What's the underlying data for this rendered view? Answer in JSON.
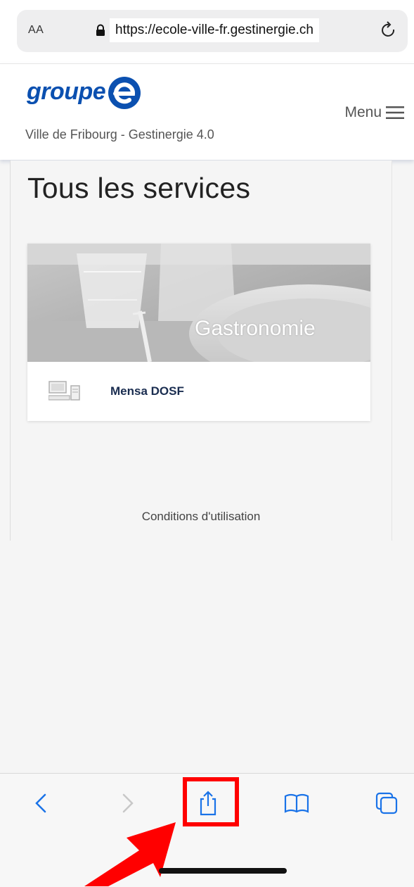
{
  "browser": {
    "text_size_label": "AA",
    "url": "https://ecole-ville-fr.gestinergie.ch"
  },
  "header": {
    "logo_text": "groupe",
    "subtitle": "Ville de Fribourg - Gestinergie 4.0",
    "menu_label": "Menu"
  },
  "main": {
    "title": "Tous les services",
    "service_card": {
      "category": "Gastronomie",
      "items": [
        {
          "label": "Mensa DOSF"
        }
      ]
    },
    "footer_link": "Conditions d'utilisation"
  },
  "colors": {
    "brand": "#0b50b0",
    "annotation": "#ff0000",
    "toolbar_icon": "#1a73e8"
  },
  "toolbar": {
    "icons": [
      "back-icon",
      "forward-icon",
      "share-icon",
      "bookmarks-icon",
      "tabs-icon"
    ]
  }
}
